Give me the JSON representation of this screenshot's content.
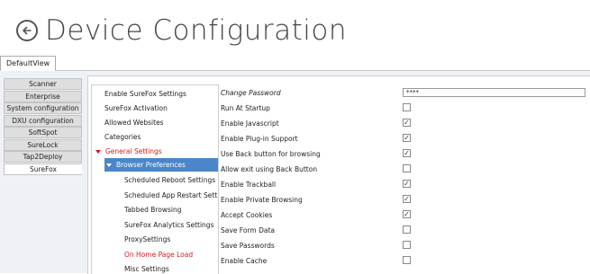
{
  "header": {
    "title": "Device Configuration",
    "back_icon": "circle-arrow-left-icon"
  },
  "tabs": [
    {
      "label": "DefaultView"
    }
  ],
  "nav": {
    "items": [
      {
        "label": "Scanner"
      },
      {
        "label": "Enterprise"
      },
      {
        "label": "System configuration"
      },
      {
        "label": "DXU configuration"
      },
      {
        "label": "SoftSpot"
      },
      {
        "label": "SureLock"
      },
      {
        "label": "Tap2Deploy"
      },
      {
        "label": "SureFox"
      }
    ],
    "active": "SureFox"
  },
  "tree": {
    "items": [
      {
        "label": "Enable SureFox Settings"
      },
      {
        "label": "SureFox Activation"
      },
      {
        "label": "Allowed Websites"
      },
      {
        "label": "Categories"
      },
      {
        "label": "General Settings"
      },
      {
        "label": "Browser Preferences"
      },
      {
        "label": "Scheduled Reboot Settings"
      },
      {
        "label": "Scheduled App Restart Settings"
      },
      {
        "label": "Tabbed Browsing"
      },
      {
        "label": "SureFox Analytics Settings"
      },
      {
        "label": "ProxySettings"
      },
      {
        "label": "On Home Page Load"
      },
      {
        "label": "Misc Settings"
      }
    ],
    "selected": "Browser Preferences"
  },
  "settings": {
    "rows": [
      {
        "label": "Change Password",
        "type": "password",
        "value": "****"
      },
      {
        "label": "Run At Startup",
        "type": "checkbox",
        "checked": false
      },
      {
        "label": "Enable Javascript",
        "type": "checkbox",
        "checked": true
      },
      {
        "label": "Enable Plug-in Support",
        "type": "checkbox",
        "checked": true
      },
      {
        "label": "Use Back button for browsing",
        "type": "checkbox",
        "checked": true
      },
      {
        "label": "Allow exit using Back Button",
        "type": "checkbox",
        "checked": false
      },
      {
        "label": "Enable Trackball",
        "type": "checkbox",
        "checked": true
      },
      {
        "label": "Enable Private Browsing",
        "type": "checkbox",
        "checked": true
      },
      {
        "label": "Accept Cookies",
        "type": "checkbox",
        "checked": true
      },
      {
        "label": "Save Form Data",
        "type": "checkbox",
        "checked": false
      },
      {
        "label": "Save Passwords",
        "type": "checkbox",
        "checked": false
      },
      {
        "label": "Enable Cache",
        "type": "checkbox",
        "checked": false
      }
    ],
    "check_glyph": "✓"
  },
  "colors": {
    "accent": "#4a86c9",
    "highlight_red": "#d61a1a"
  }
}
